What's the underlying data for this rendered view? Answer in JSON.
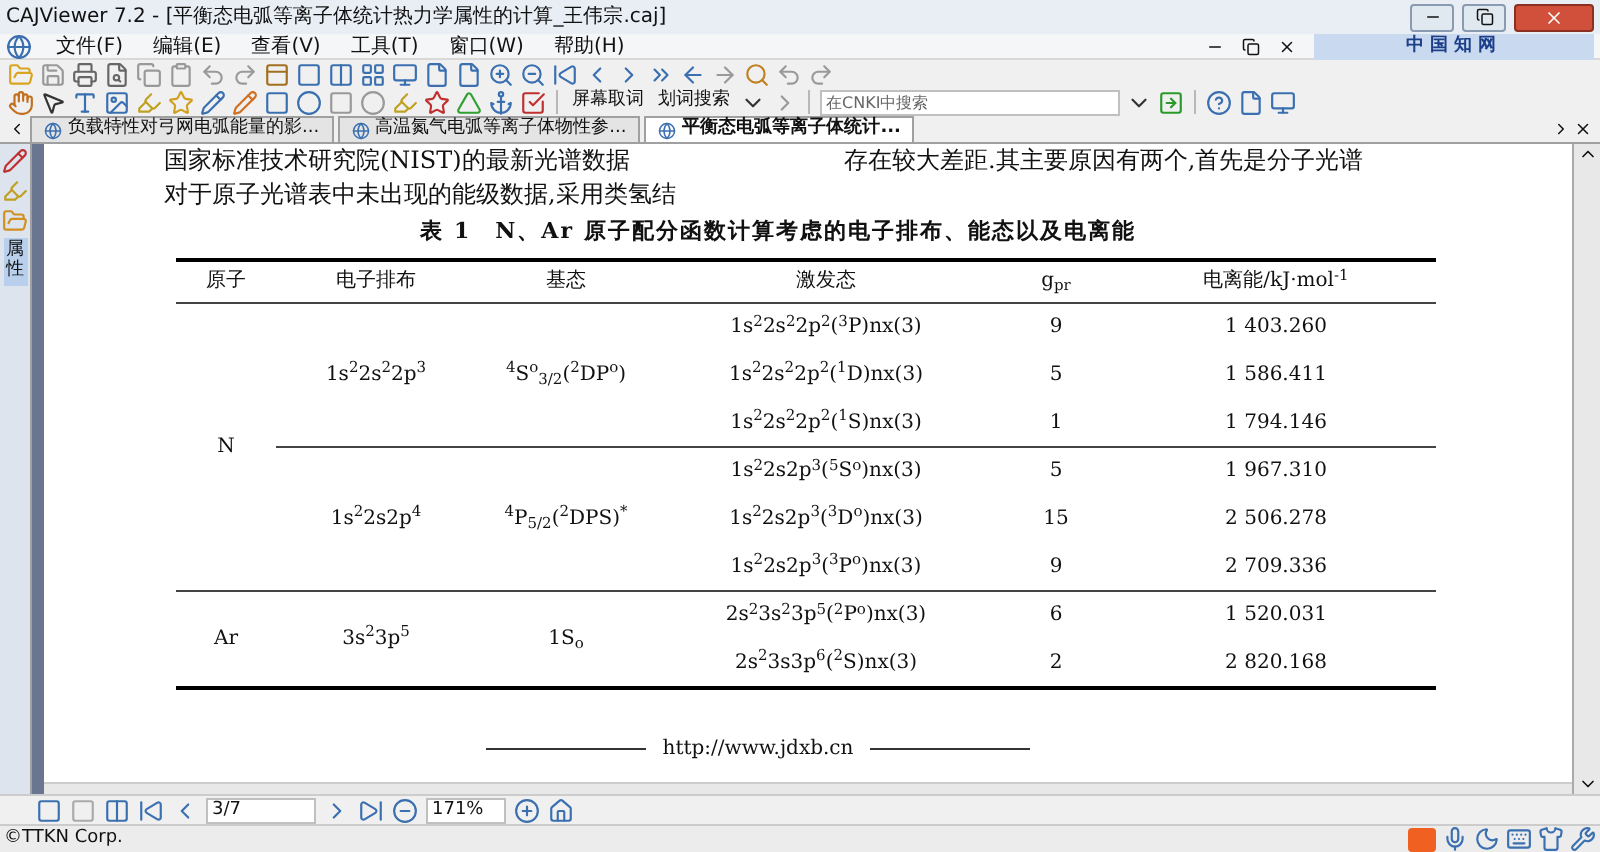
{
  "window": {
    "title": "CAJViewer 7.2 - [平衡态电弧等离子体统计热力学属性的计算_王伟宗.caj]"
  },
  "menu": [
    "文件(F)",
    "编辑(E)",
    "查看(V)",
    "工具(T)",
    "窗口(W)",
    "帮助(H)"
  ],
  "brand": "中国知网",
  "toolbar": {
    "screen_word": "屏幕取词",
    "word_search": "划词搜索",
    "search_placeholder": "在CNKI中搜索"
  },
  "tabs": [
    {
      "label": "负载特性对弓网电弧能量的影...",
      "selected": false
    },
    {
      "label": "高温氮气电弧等离子体物性参...",
      "selected": false
    },
    {
      "label": "平衡态电弧等离子体统计...",
      "selected": true
    }
  ],
  "side_panel": {
    "label": "属性"
  },
  "document": {
    "left_lines": [
      "国家标准技术研究院(NIST)的最新光谱数据",
      "对于原子光谱表中未出现的能级数据,采用类氢结"
    ],
    "right_line": "存在较大差距.其主要原因有两个,首先是分子光谱",
    "caption": "表 1　N、Ar 原子配分函数计算考虑的电子排布、能态以及电离能",
    "table": {
      "columns": [
        "原子",
        "电子排布",
        "基态",
        "激发态",
        "g$_{pr}$",
        "电离能/kJ·mol$^{-1}$"
      ],
      "groups": [
        {
          "atom": "N",
          "subgroups": [
            {
              "config": "1s$^{2}$2s$^{2}$2p$^{3}$",
              "ground": "$^{4}$S$^{o}$$_{3/2}$($^{2}$DP$^{o}$)",
              "rows": [
                {
                  "excited": "1s$^{2}$2s$^{2}$2p$^{2}$($^{3}$P)nx(3)",
                  "g": "9",
                  "energy": "1 403.260"
                },
                {
                  "excited": "1s$^{2}$2s$^{2}$2p$^{2}$($^{1}$D)nx(3)",
                  "g": "5",
                  "energy": "1 586.411"
                },
                {
                  "excited": "1s$^{2}$2s$^{2}$2p$^{2}$($^{1}$S)nx(3)",
                  "g": "1",
                  "energy": "1 794.146"
                }
              ]
            },
            {
              "config": "1s$^{2}$2s2p$^{4}$",
              "ground": "$^{4}$P$_{5/2}$($^{2}$DPS)$^{*}$",
              "rows": [
                {
                  "excited": "1s$^{2}$2s2p$^{3}$($^{5}$S$^{o}$)nx(3)",
                  "g": "5",
                  "energy": "1 967.310"
                },
                {
                  "excited": "1s$^{2}$2s2p$^{3}$($^{3}$D$^{o}$)nx(3)",
                  "g": "15",
                  "energy": "2 506.278"
                },
                {
                  "excited": "1s$^{2}$2s2p$^{3}$($^{3}$P$^{o}$)nx(3)",
                  "g": "9",
                  "energy": "2 709.336"
                }
              ]
            }
          ]
        },
        {
          "atom": "Ar",
          "subgroups": [
            {
              "config": "3s$^{2}$3p$^{5}$",
              "ground": "1S$_{o}$",
              "rows": [
                {
                  "excited": "2s$^{2}$3s$^{2}$3p$^{5}$($^{2}$P$^{o}$)nx(3)",
                  "g": "6",
                  "energy": "1 520.031"
                },
                {
                  "excited": "2s$^{2}$3s3p$^{6}$($^{2}$S)nx(3)",
                  "g": "2",
                  "energy": "2 820.168"
                }
              ]
            }
          ]
        }
      ]
    },
    "footer_url": "http://www.jdxb.cn"
  },
  "nav": {
    "page": "3/7",
    "zoom": "171%"
  },
  "status_bar": {
    "text": "©TTKN Corp."
  }
}
